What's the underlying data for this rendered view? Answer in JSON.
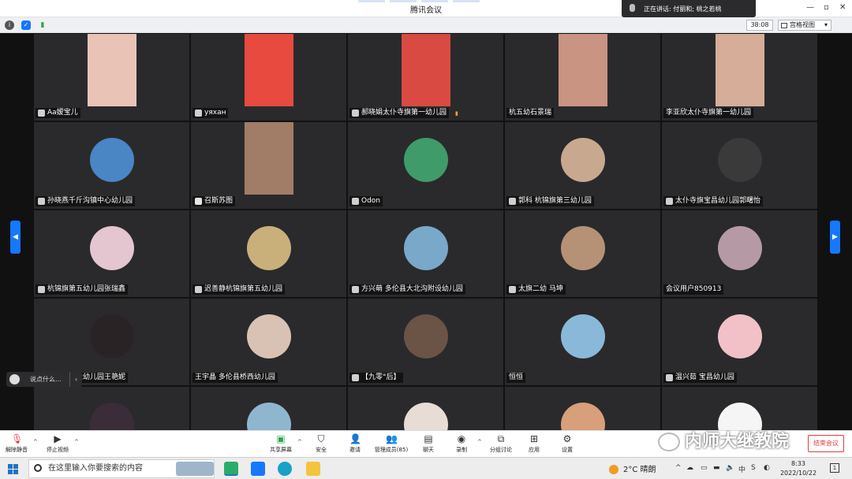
{
  "window": {
    "title": "腾讯会议"
  },
  "speaking": {
    "text": "正在讲话: 付丽和; 桃之若桃"
  },
  "infobar": {
    "timer": "38:08",
    "view_label": "宫格视图"
  },
  "participants": [
    {
      "name": "Aa嫒宝儿",
      "mic": "muted",
      "kind": "video",
      "color": "#e9c3b6"
    },
    {
      "name": "yяxан",
      "mic": "muted",
      "kind": "video",
      "color": "#e84a3f"
    },
    {
      "name": "郝晓娟太仆寺旗第一幼儿园",
      "mic": "muted",
      "kind": "video",
      "color": "#d84a42",
      "signal": true
    },
    {
      "name": "杭五幼石景瑞",
      "mic": "none",
      "kind": "video",
      "color": "#c99482"
    },
    {
      "name": "李亚欣太仆寺旗第一幼儿园",
      "mic": "none",
      "kind": "video",
      "color": "#d5ad99"
    },
    {
      "name": "孙晓燕千斤沟镇中心幼儿园",
      "mic": "muted",
      "kind": "avatar",
      "color": "#4a86c4"
    },
    {
      "name": "召斯苏图",
      "mic": "on",
      "kind": "video",
      "color": "#a17c66"
    },
    {
      "name": "Odon",
      "mic": "muted",
      "kind": "avatar",
      "color": "#3f9b6a"
    },
    {
      "name": "郭科 杭锦旗第三幼儿园",
      "mic": "muted",
      "kind": "avatar",
      "color": "#c8a98f"
    },
    {
      "name": "太仆寺旗宝昌幼儿园郭曙怡",
      "mic": "muted",
      "kind": "avatar",
      "color": "#3a3a3a"
    },
    {
      "name": "杭锦旗第五幼儿园张瑞鑫",
      "mic": "muted",
      "kind": "avatar",
      "color": "#e3c6cf"
    },
    {
      "name": "迟善静杭锦旗第五幼儿园",
      "mic": "muted",
      "kind": "avatar",
      "color": "#c9b07a"
    },
    {
      "name": "方兴萌  多伦县大北沟附设幼儿园",
      "mic": "muted",
      "kind": "avatar",
      "color": "#79a8c9"
    },
    {
      "name": "太旗二幼 马坤",
      "mic": "muted",
      "kind": "avatar",
      "color": "#b59276"
    },
    {
      "name": "会议用户850913",
      "mic": "none",
      "kind": "avatar",
      "color": "#b59aa6"
    },
    {
      "name": "杭锦旗第六幼儿园王艳妮",
      "mic": "muted",
      "kind": "avatar",
      "color": "#2a2326"
    },
    {
      "name": "王宇晶 多伦县桥西幼儿园",
      "mic": "none",
      "kind": "avatar",
      "color": "#d9c2b3"
    },
    {
      "name": "【九零°后】",
      "mic": "muted",
      "kind": "avatar",
      "color": "#6b5346"
    },
    {
      "name": "恒恒",
      "mic": "none",
      "kind": "avatar",
      "color": "#8ab8d8"
    },
    {
      "name": "温兴茹  宝昌幼儿园",
      "mic": "muted",
      "kind": "avatar",
      "color": "#f1c1c7"
    },
    {
      "name": "",
      "mic": "none",
      "kind": "avatar",
      "color": "#3b2c3a"
    },
    {
      "name": "",
      "mic": "none",
      "kind": "avatar",
      "color": "#8fb6cf"
    },
    {
      "name": "",
      "mic": "none",
      "kind": "avatar",
      "color": "#e8ddd5"
    },
    {
      "name": "",
      "mic": "none",
      "kind": "avatar",
      "color": "#d7a07a"
    },
    {
      "name": "",
      "mic": "none",
      "kind": "avatar",
      "color": "#f5f5f5"
    }
  ],
  "chat": {
    "placeholder": "说点什么..."
  },
  "toolbar": {
    "unmute": "解除静音",
    "start_video": "停止视频",
    "share": "共享屏幕",
    "security": "安全",
    "invite": "邀请",
    "members": "管理成员(85)",
    "chat": "聊天",
    "record": "录制",
    "breakout": "分组讨论",
    "apps": "应用",
    "settings": "设置",
    "end": "结束会议"
  },
  "watermark": {
    "text": "内师大继教院"
  },
  "taskbar": {
    "search_placeholder": "在这里输入你要搜索的内容",
    "weather": "2°C 晴朗",
    "time": "8:33",
    "date": "2022/10/22",
    "notifications": "1"
  },
  "colors": {
    "accent": "#1677ff",
    "end": "#e23b3b",
    "signal": "#f0a23a"
  }
}
